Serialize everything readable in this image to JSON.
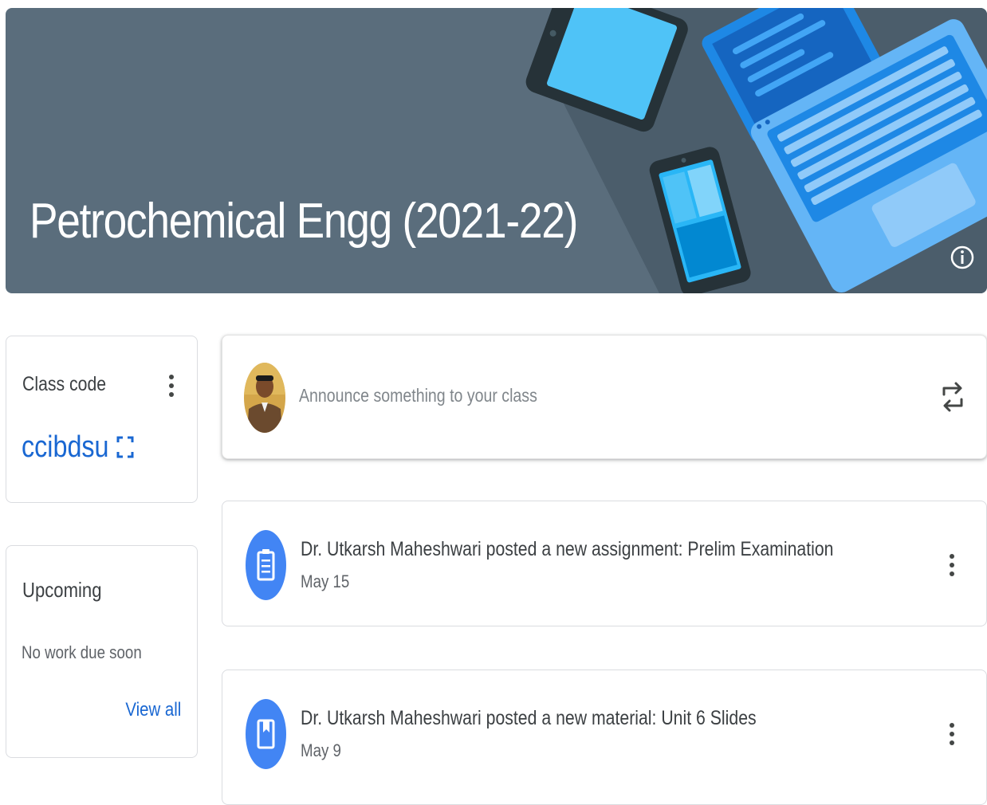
{
  "banner": {
    "title": "Petrochemical Engg (2021-22)",
    "info_icon": "info-icon",
    "background_color": "#5a6d7c"
  },
  "class_code": {
    "label": "Class code",
    "code": "ccibdsu",
    "menu_icon": "more-vert-icon",
    "display_icon": "fullscreen-icon"
  },
  "upcoming": {
    "title": "Upcoming",
    "empty_text": "No work due soon",
    "view_all_label": "View all"
  },
  "announce": {
    "placeholder": "Announce something to your class",
    "repost_icon": "repost-icon"
  },
  "stream": [
    {
      "title": "Dr. Utkarsh Maheshwari posted a new assignment: Prelim Examination",
      "date": "May 15",
      "icon": "assignment-icon"
    },
    {
      "title": "Dr. Utkarsh Maheshwari posted a new material: Unit 6 Slides",
      "date": "May 9",
      "icon": "material-book-icon"
    }
  ],
  "colors": {
    "accent": "#1967d2",
    "icon_circle": "#4285f4",
    "text_primary": "#3c4043",
    "text_secondary": "#5f6368"
  }
}
